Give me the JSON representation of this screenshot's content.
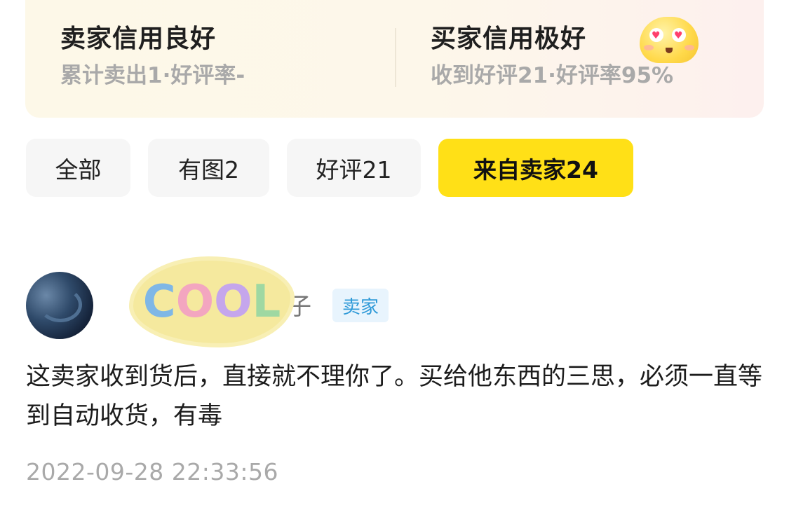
{
  "credit": {
    "seller": {
      "title": "卖家信用良好",
      "stats": "累计卖出1·好评率-"
    },
    "buyer": {
      "title": "买家信用极好",
      "stats": "收到好评21·好评率95%",
      "emoji_icon": "heart-eyes-emoji"
    }
  },
  "tabs": [
    {
      "label": "全部",
      "active": false
    },
    {
      "label": "有图2",
      "active": false
    },
    {
      "label": "好评21",
      "active": false
    },
    {
      "label": "来自卖家24",
      "active": true
    }
  ],
  "review": {
    "username_visible_tail": "子",
    "sticker_text": [
      "C",
      "O",
      "O",
      "L"
    ],
    "badge": "卖家",
    "comment": "这卖家收到货后，直接就不理你了。买给他东西的三思，必须一直等到自动收货，有毒",
    "timestamp": "2022-09-28 22:33:56"
  },
  "colors": {
    "accent_yellow": "#ffe017",
    "badge_blue": "#2f9ad8",
    "muted_gray": "#a9a9a9"
  }
}
